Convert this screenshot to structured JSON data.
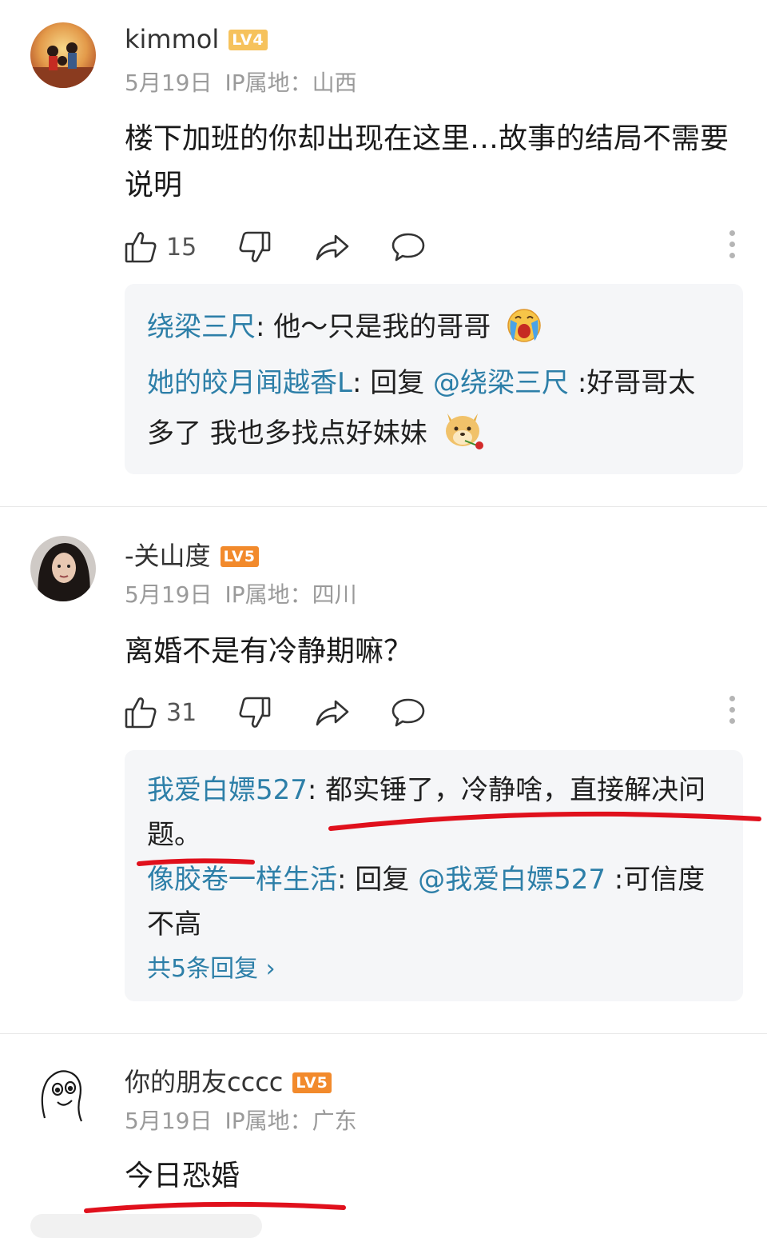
{
  "comments": [
    {
      "username": "kimmol",
      "level": "LV4",
      "level_color": "#f6c25c",
      "date": "5月19日",
      "ip": "IP属地：山西",
      "text": "楼下加班的你却出现在这里…故事的结局不需要说明",
      "likes": "15",
      "replies": [
        {
          "name": "绕梁三尺",
          "sep": ": ",
          "text": "他～只是我的哥哥",
          "emoji": "crying-emoji"
        },
        {
          "name": "她的皎月闻越香L",
          "sep": ": ",
          "prefix": "回复 ",
          "at": "@绕梁三尺",
          "text": " :好哥哥太多了 我也多找点好妹妹",
          "emoji": "doge-rose-emoji"
        }
      ]
    },
    {
      "username": "-关山度",
      "level": "LV5",
      "level_color": "#f28a2c",
      "date": "5月19日",
      "ip": "IP属地：四川",
      "text": "离婚不是有冷静期嘛？",
      "likes": "31",
      "replies": [
        {
          "name": "我爱白嫖527",
          "sep": ": ",
          "text": "都实锤了，冷静啥，直接解决问题。"
        },
        {
          "name": "像胶卷一样生活",
          "sep": ": ",
          "prefix": "回复 ",
          "at": "@我爱白嫖527",
          "text": " :可信度不高"
        }
      ],
      "more_replies": "共5条回复 ›"
    },
    {
      "username": "你的朋友cccc",
      "level": "LV5",
      "level_color": "#f28a2c",
      "date": "5月19日",
      "ip": "IP属地：广东",
      "text": "今日恐婚"
    }
  ],
  "colors": {
    "reply_name": "#2d7fa8",
    "annotation_red": "#e0101c"
  }
}
